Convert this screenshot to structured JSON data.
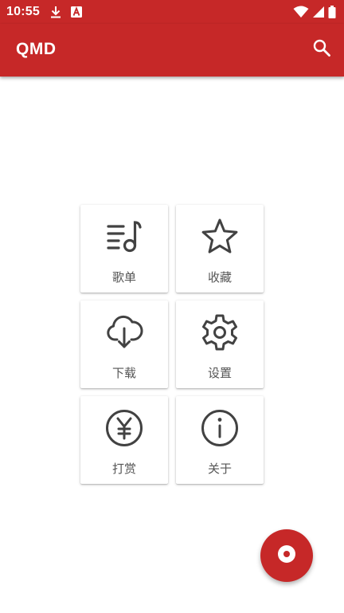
{
  "colors": {
    "primary": "#C62828",
    "icon": "#424242",
    "label": "#555555"
  },
  "status_bar": {
    "time": "10:55",
    "left_icons": [
      "download-icon",
      "font-a-icon"
    ],
    "right_icons": [
      "wifi-icon",
      "signal-icon",
      "battery-icon"
    ]
  },
  "app_bar": {
    "title": "QMD",
    "search_icon": "search-icon"
  },
  "menu": [
    {
      "label": "歌单",
      "icon": "playlist-icon"
    },
    {
      "label": "收藏",
      "icon": "star-icon"
    },
    {
      "label": "下载",
      "icon": "cloud-download-icon"
    },
    {
      "label": "设置",
      "icon": "settings-icon"
    },
    {
      "label": "打赏",
      "icon": "yen-icon"
    },
    {
      "label": "关于",
      "icon": "info-icon"
    }
  ],
  "fab": {
    "icon": "disc-icon"
  }
}
